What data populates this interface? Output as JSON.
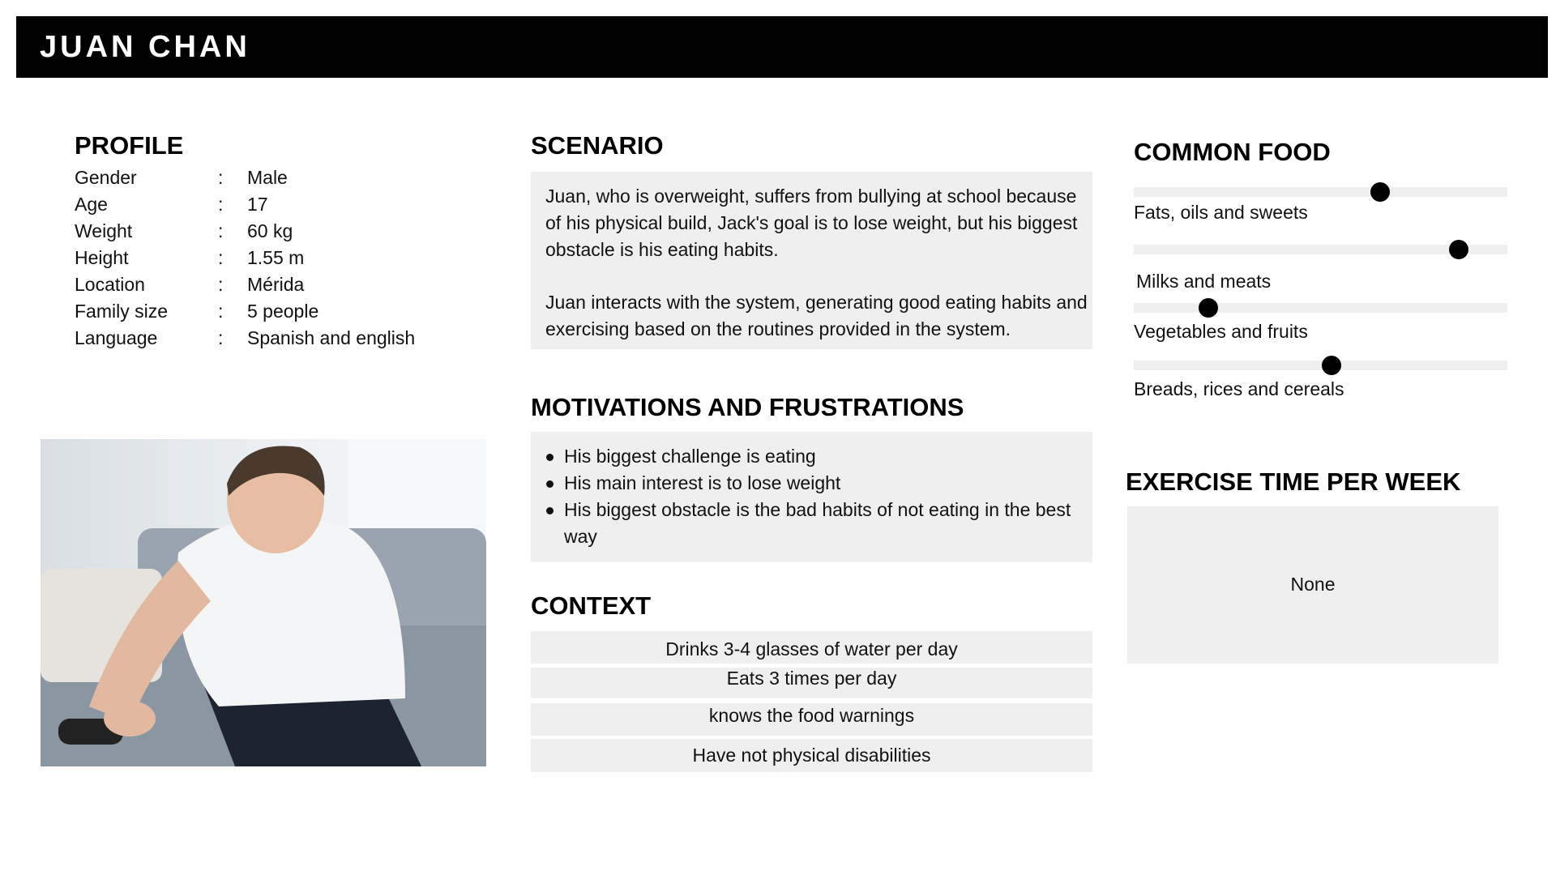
{
  "header": {
    "name": "JUAN CHAN"
  },
  "profile": {
    "title": "PROFILE",
    "colon": ":",
    "rows": [
      {
        "label": "Gender",
        "value": "Male"
      },
      {
        "label": "Age",
        "value": "17"
      },
      {
        "label": "Weight",
        "value": "60 kg"
      },
      {
        "label": "Height",
        "value": "1.55 m"
      },
      {
        "label": "Location",
        "value": "Mérida"
      },
      {
        "label": "Family size",
        "value": "5 people"
      },
      {
        "label": "Language",
        "value": "Spanish and english"
      }
    ]
  },
  "scenario": {
    "title": "SCENARIO",
    "paragraphs": [
      "Juan, who is overweight, suffers from bullying at school because of his physical build, Jack's goal is to lose weight, but his biggest obstacle is his eating habits.",
      "Juan interacts with the system, generating good eating habits and exercising based on the routines provided in the system."
    ]
  },
  "motivations": {
    "title": "MOTIVATIONS AND FRUSTRATIONS",
    "items": [
      "His biggest challenge is eating",
      "His main interest is to lose weight",
      "His biggest obstacle is the bad habits of not eating in the best way"
    ]
  },
  "context": {
    "title": "CONTEXT",
    "items": [
      "Drinks 3-4 glasses of water per day",
      "Eats 3 times per day",
      "knows the food warnings",
      "Have not physical disabilities"
    ]
  },
  "common_food": {
    "title": "COMMON FOOD",
    "items": [
      {
        "label": "Fats, oils and sweets",
        "level": 0.66
      },
      {
        "label": "Milks and meats",
        "level": 0.87
      },
      {
        "label": "Vegetables and fruits",
        "level": 0.2
      },
      {
        "label": "Breads, rices and cereals",
        "level": 0.53
      }
    ]
  },
  "exercise": {
    "title": "EXERCISE TIME PER WEEK",
    "value": "None"
  },
  "colors": {
    "header_bg": "#000000",
    "panel_bg": "#efefef",
    "knob": "#000000"
  }
}
